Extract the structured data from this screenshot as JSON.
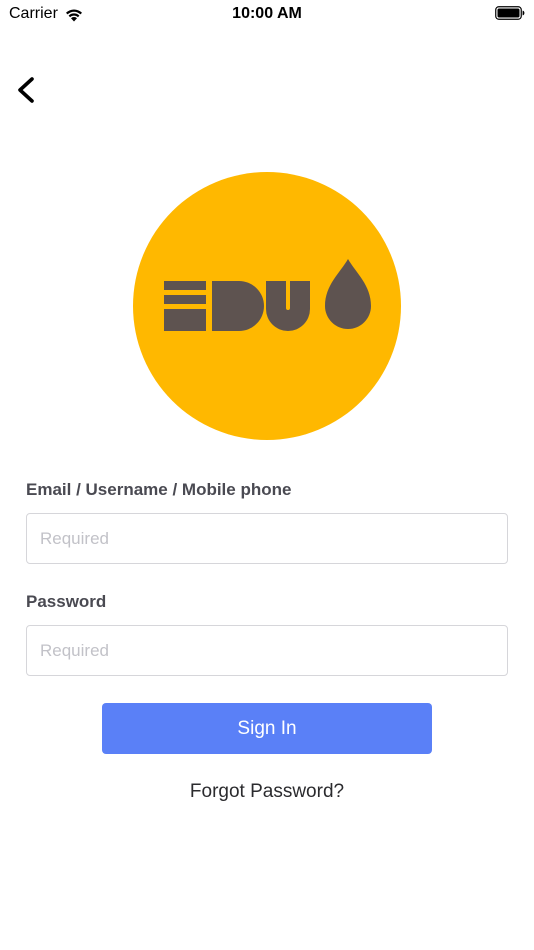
{
  "status_bar": {
    "carrier": "Carrier",
    "time": "10:00 AM"
  },
  "colors": {
    "logo_background": "#FFB800",
    "logo_mark": "#5E5350",
    "primary_button": "#5A80F7",
    "label_text": "#4A4A52",
    "placeholder": "#C2C2C8"
  },
  "icons": {
    "back": "chevron-left-icon",
    "wifi": "wifi-icon",
    "battery": "battery-icon",
    "logo": "eduo-logo"
  },
  "form": {
    "email_label": "Email / Username / Mobile phone",
    "email_placeholder": "Required",
    "email_value": "",
    "password_label": "Password",
    "password_placeholder": "Required",
    "password_value": "",
    "sign_in_label": "Sign In",
    "forgot_password_label": "Forgot Password?"
  }
}
